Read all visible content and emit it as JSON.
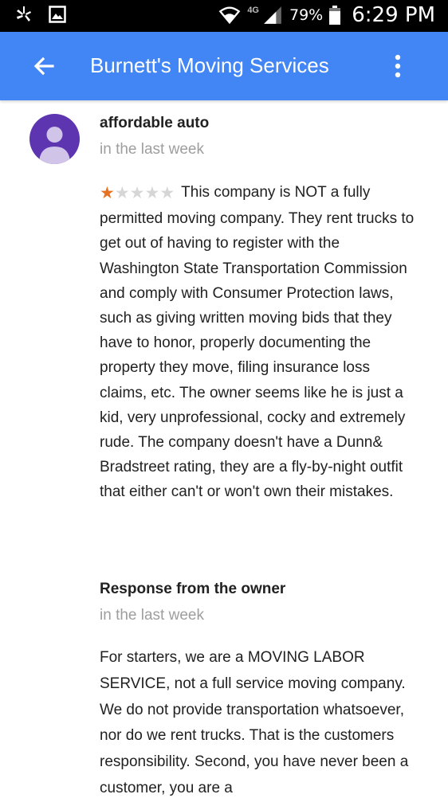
{
  "status_bar": {
    "network_label": "4G",
    "battery_percent": "79%",
    "time": "6:29 PM",
    "icons": [
      "yelp-icon",
      "gallery-icon",
      "wifi-icon",
      "signal-icon",
      "battery-icon"
    ]
  },
  "app_bar": {
    "title": "Burnett's Moving Services",
    "back_icon": "arrow-back-icon",
    "more_icon": "more-vert-icon",
    "color": "#4285f4"
  },
  "review": {
    "author": "affordable auto",
    "time": "in the last week",
    "rating": 1,
    "rating_max": 5,
    "star_color": "#e8711f",
    "text": "This company is NOT a fully permitted moving company.  They rent trucks to get out of having to register with the Washington State Transportation Commission and comply with Consumer Protection laws, such as giving written moving bids that they have to honor, properly documenting the property they move, filing insurance loss claims, etc. The owner seems like he is just a kid, very unprofessional, cocky and extremely rude. The company doesn't have a Dunn& Bradstreet rating, they are a fly-by-night outfit that either can't or won't own their mistakes.",
    "avatar_color": "#5e35b1"
  },
  "owner_response": {
    "heading": "Response from the owner",
    "time": "in the last week",
    "text": "For starters, we are a MOVING LABOR SERVICE, not a full service moving company. We do not provide transportation whatsoever, nor do we rent trucks. That is the customers responsibility. Second, you have never been a customer, you are a"
  }
}
